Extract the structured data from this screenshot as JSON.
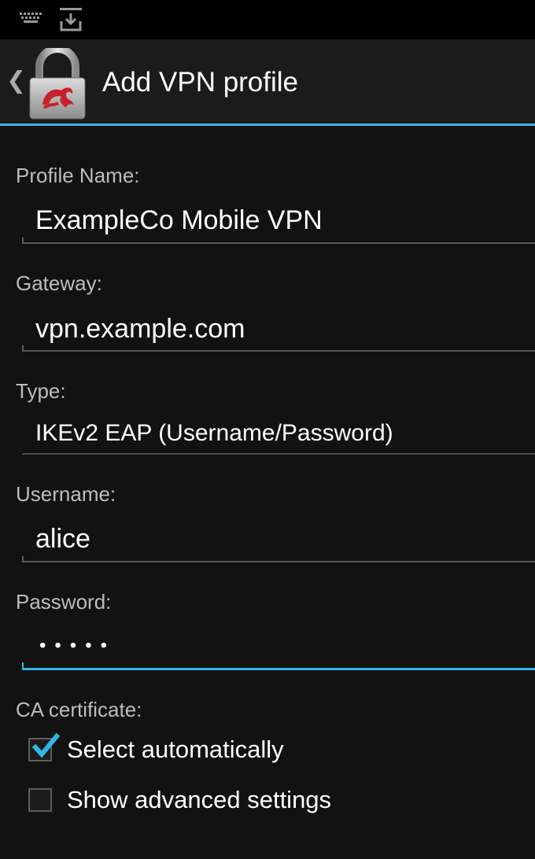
{
  "status_bar": {
    "icons": [
      "keyboard-icon",
      "download-tray-icon"
    ]
  },
  "action_bar": {
    "back_icon": "chevron-left-icon",
    "app_icon": "strongswan-lock-icon",
    "title": "Add VPN profile"
  },
  "form": {
    "profile_name": {
      "label": "Profile Name:",
      "value": "ExampleCo Mobile VPN"
    },
    "gateway": {
      "label": "Gateway:",
      "value": "vpn.example.com"
    },
    "type": {
      "label": "Type:",
      "value": "IKEv2 EAP (Username/Password)"
    },
    "username": {
      "label": "Username:",
      "value": "alice"
    },
    "password": {
      "label": "Password:",
      "masked_value": "•••••",
      "focused": true
    },
    "ca_certificate": {
      "label": "CA certificate:",
      "select_automatically": {
        "label": "Select automatically",
        "checked": true
      }
    },
    "advanced": {
      "label": "Show advanced settings",
      "checked": false
    }
  },
  "colors": {
    "accent": "#33b5e5",
    "background": "#121212",
    "action_bar": "#1b1b1b",
    "lock_red": "#c8202a"
  }
}
